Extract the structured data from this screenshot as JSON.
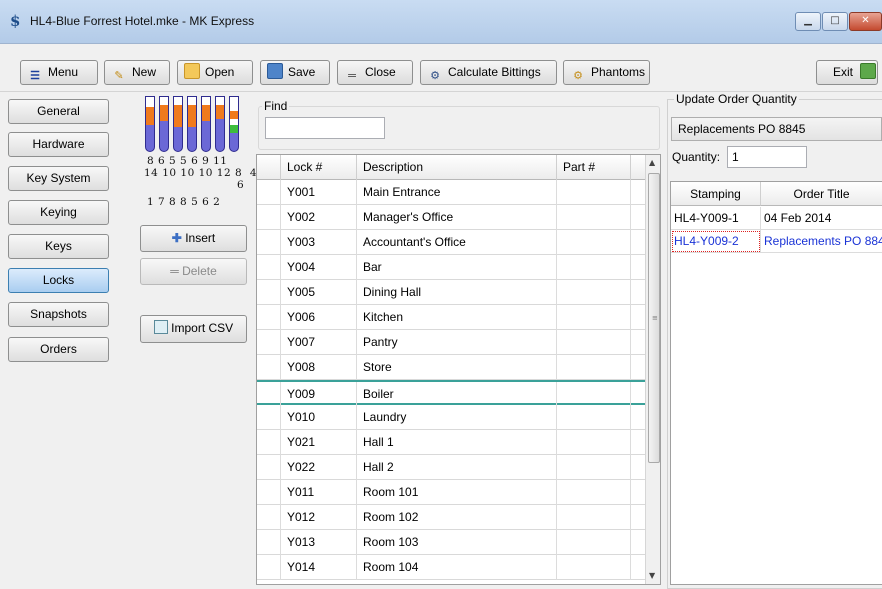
{
  "window": {
    "title": "HL4-Blue Forrest Hotel.mke - MK Express"
  },
  "toolbar": {
    "menu": "Menu",
    "new": "New",
    "open": "Open",
    "save": "Save",
    "close": "Close",
    "calculate": "Calculate Bittings",
    "phantoms": "Phantoms",
    "exit": "Exit"
  },
  "nav": [
    "General",
    "Hardware",
    "Key System",
    "Keying",
    "Keys",
    "Locks",
    "Snapshots",
    "Orders"
  ],
  "active_nav": "Locks",
  "pins": {
    "row1": "8 6 5 5 6 9 11",
    "row2": "14 10 10 10 12 8  4",
    "row3": "6",
    "row4": "1 7 8 8 5 6 2"
  },
  "actions": {
    "insert": "Insert",
    "delete": "Delete",
    "import_csv": "Import CSV"
  },
  "find": {
    "label": "Find",
    "value": ""
  },
  "grid": {
    "headers": [
      "Lock #",
      "Description",
      "Part #"
    ],
    "rows": [
      [
        "Y001",
        "Main Entrance",
        ""
      ],
      [
        "Y002",
        "Manager's Office",
        ""
      ],
      [
        "Y003",
        "Accountant's Office",
        ""
      ],
      [
        "Y004",
        "Bar",
        ""
      ],
      [
        "Y005",
        "Dining Hall",
        ""
      ],
      [
        "Y006",
        "Kitchen",
        ""
      ],
      [
        "Y007",
        "Pantry",
        ""
      ],
      [
        "Y008",
        "Store",
        ""
      ],
      [
        "Y009",
        "Boiler",
        ""
      ],
      [
        "Y010",
        "Laundry",
        ""
      ],
      [
        "Y021",
        "Hall 1",
        ""
      ],
      [
        "Y022",
        "Hall 2",
        ""
      ],
      [
        "Y011",
        "Room 101",
        ""
      ],
      [
        "Y012",
        "Room 102",
        ""
      ],
      [
        "Y013",
        "Room 103",
        ""
      ],
      [
        "Y014",
        "Room 104",
        ""
      ]
    ],
    "current_row": 8
  },
  "update_order": {
    "label": "Update Order Quantity",
    "selected_order": "Replacements PO 8845",
    "quantity_label": "Quantity:",
    "quantity": "1",
    "headers": [
      "Stamping",
      "Order Title"
    ],
    "rows": [
      [
        "HL4-Y009-1",
        "04 Feb 2014"
      ],
      [
        "HL4-Y009-2",
        "Replacements PO 884"
      ]
    ],
    "selected_row": 1
  }
}
